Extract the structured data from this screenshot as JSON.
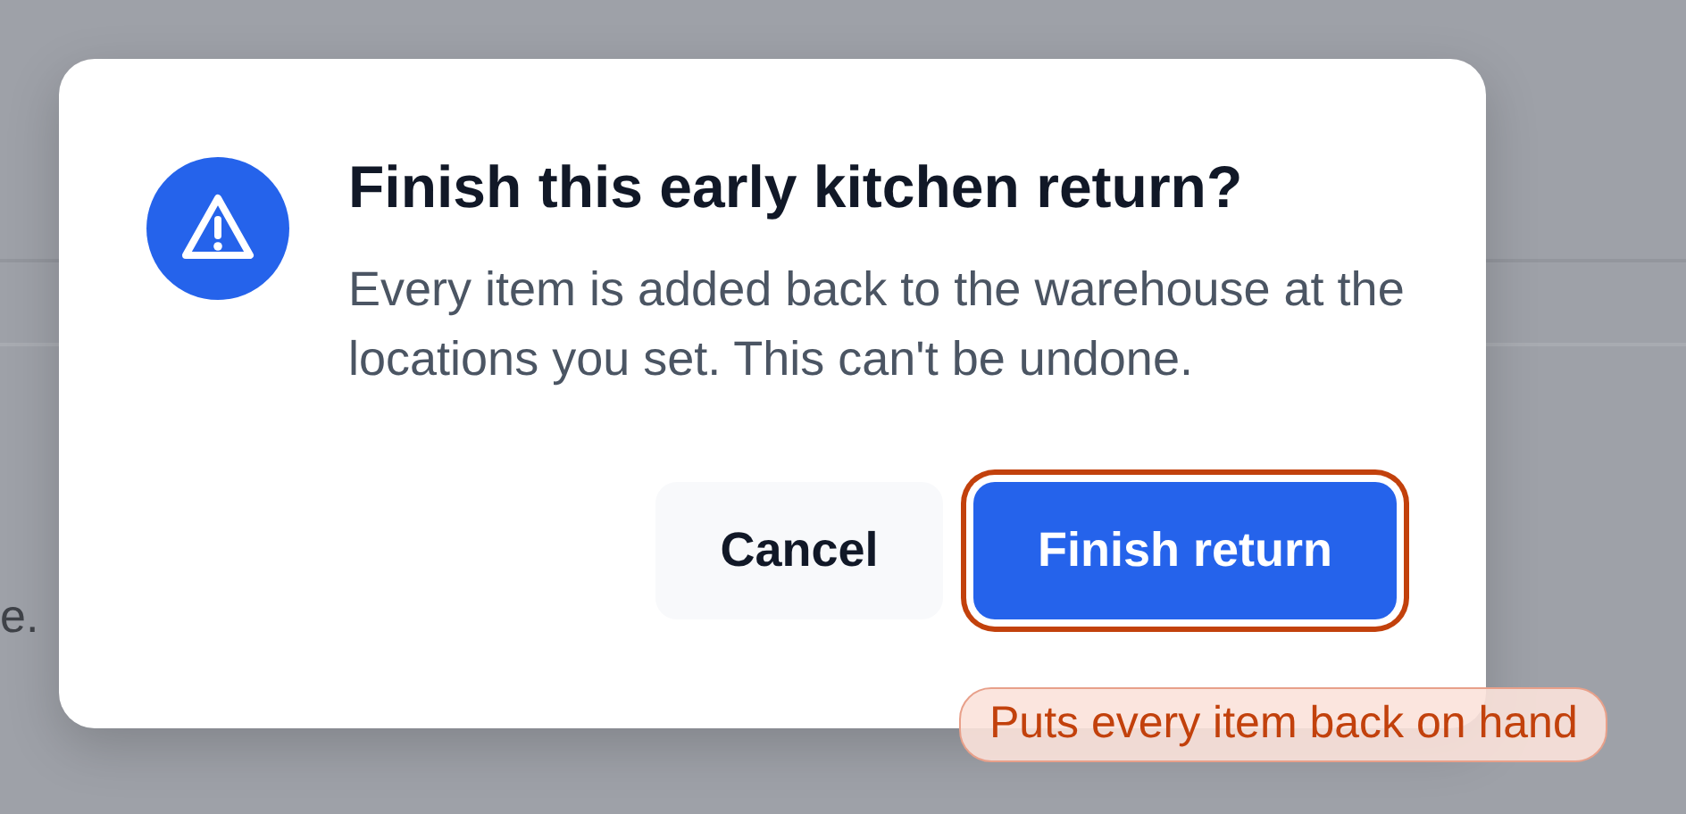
{
  "background": {
    "text": "e."
  },
  "dialog": {
    "title": "Finish this early kitchen return?",
    "message": "Every item is added back to the warehouse at the locations you set. This can't be undone.",
    "buttons": [
      {
        "label": "Cancel",
        "kind": "secondary",
        "focused": false
      },
      {
        "label": "Finish return",
        "kind": "primary",
        "focused": true
      }
    ],
    "hint": "Puts every item back on hand"
  }
}
